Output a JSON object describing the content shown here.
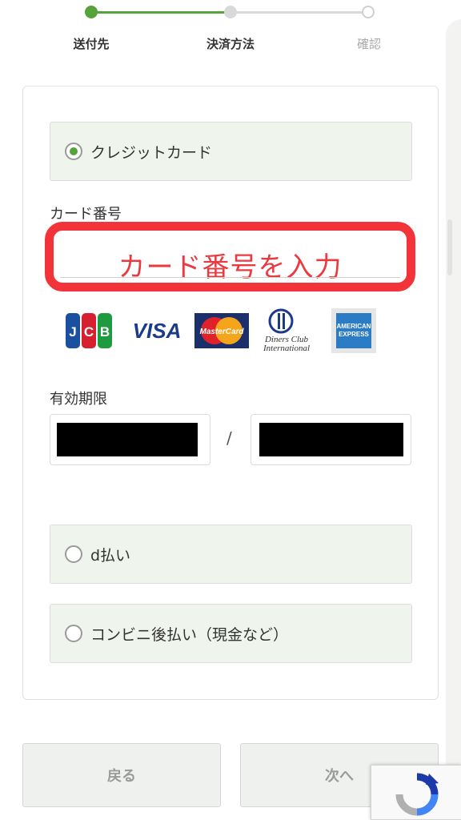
{
  "stepper": {
    "steps": [
      {
        "label": "送付先",
        "state": "done"
      },
      {
        "label": "決済方法",
        "state": "current"
      },
      {
        "label": "確認",
        "state": "upcoming"
      }
    ],
    "colors": {
      "active": "#55a33a",
      "inactive": "#d9d9d9",
      "upcoming_text": "#aaaaaa"
    }
  },
  "payment": {
    "credit_card": {
      "label": "クレジットカード",
      "selected": true
    },
    "card_number": {
      "label": "カード番号",
      "placeholder": "カード番号を入力",
      "highlight_color": "#f2333a"
    },
    "brands": [
      "JCB",
      "VISA",
      "MasterCard",
      "Diners Club International",
      "American Express"
    ],
    "expiry": {
      "label": "有効期限",
      "separator": "/"
    },
    "d_payment": {
      "label": "d払い",
      "selected": false
    },
    "convenience": {
      "label": "コンビニ後払い（現金など）",
      "selected": false
    }
  },
  "buttons": {
    "back": "戻る",
    "next": "次へ"
  }
}
